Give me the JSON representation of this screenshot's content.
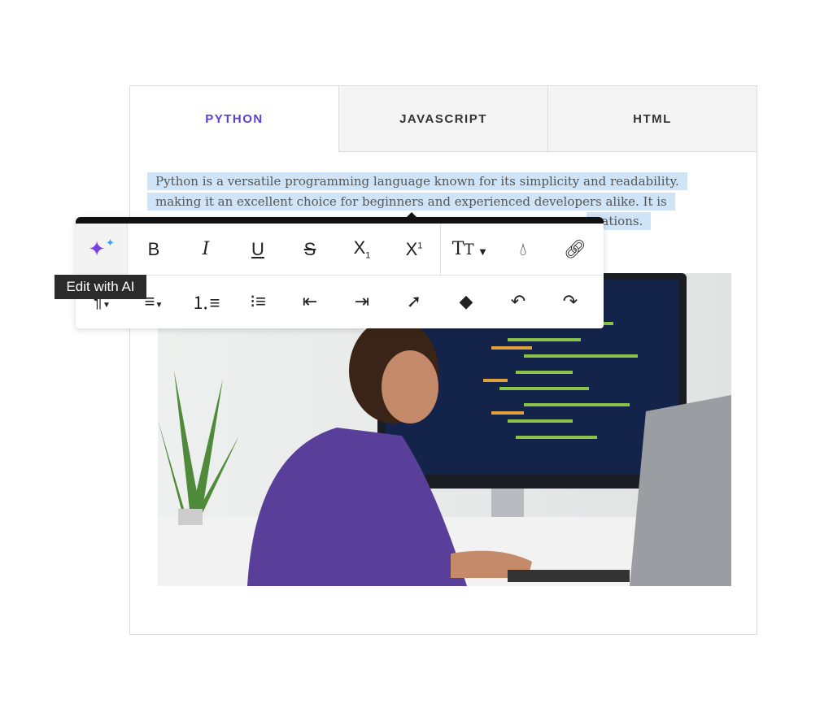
{
  "tabs": [
    {
      "label": "PYTHON",
      "active": true
    },
    {
      "label": "JAVASCRIPT",
      "active": false
    },
    {
      "label": "HTML",
      "active": false
    }
  ],
  "content": {
    "lines": [
      "Python is a versatile programming language known for its simplicity and readability.",
      "making it an excellent choice for beginners and experienced developers alike. It is",
      "cations."
    ]
  },
  "toolbar": {
    "row1": [
      "sparkles-icon",
      "bold-icon",
      "italic-icon",
      "underline-icon",
      "strikethrough-icon",
      "subscript-icon",
      "superscript-icon",
      "font-size-icon",
      "color-icon",
      "link-icon"
    ],
    "row2": [
      "paragraph-icon",
      "align-icon",
      "ordered-list-icon",
      "unordered-list-icon",
      "outdent-icon",
      "indent-icon",
      "select-icon",
      "eraser-icon",
      "undo-icon",
      "redo-icon"
    ],
    "tooltip": "Edit with AI"
  },
  "colors": {
    "accent": "#5b3fd6",
    "highlight": "#cfe4f7"
  }
}
